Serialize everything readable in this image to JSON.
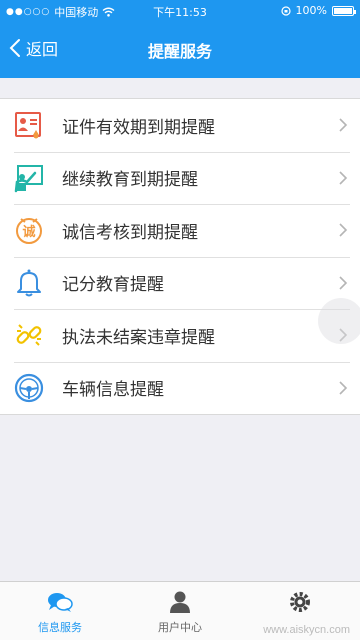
{
  "status_bar": {
    "signal_dots": "●●○○○",
    "carrier": "中国移动",
    "time": "下午11:53",
    "battery": "100%"
  },
  "nav": {
    "back_label": "返回",
    "title": "提醒服务"
  },
  "menu": [
    {
      "label": "证件有效期到期提醒",
      "icon": "certificate-icon"
    },
    {
      "label": "继续教育到期提醒",
      "icon": "teacher-board-icon"
    },
    {
      "label": "诚信考核到期提醒",
      "icon": "integrity-badge-icon"
    },
    {
      "label": "记分教育提醒",
      "icon": "bell-icon"
    },
    {
      "label": "执法未结案违章提醒",
      "icon": "broken-link-icon"
    },
    {
      "label": "车辆信息提醒",
      "icon": "steering-wheel-icon"
    }
  ],
  "tabs": [
    {
      "label": "信息服务",
      "icon": "chat-bubbles-icon",
      "active": true
    },
    {
      "label": "用户中心",
      "icon": "user-icon",
      "active": false
    },
    {
      "label": "",
      "icon": "gear-icon",
      "active": false
    }
  ],
  "watermark": "www.aiskycn.com",
  "colors": {
    "accent": "#1e97f0",
    "red": "#e65a47",
    "teal": "#23b5a8",
    "orange": "#f29a3f",
    "blue": "#3a8fe0",
    "yellow": "#f2c200"
  }
}
